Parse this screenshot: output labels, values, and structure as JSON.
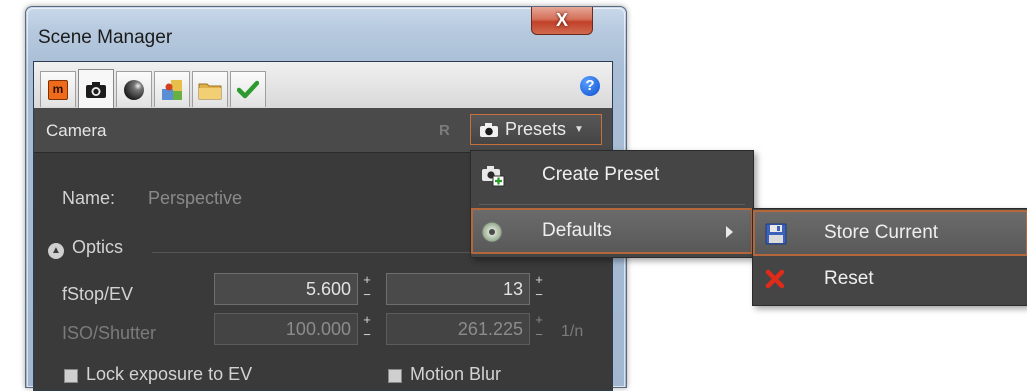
{
  "window": {
    "title": "Scene Manager",
    "close_glyph": "X"
  },
  "tabs": [
    {
      "name": "tab-maxwell",
      "icon": "maxwell-logo-icon"
    },
    {
      "name": "tab-camera",
      "icon": "camera-icon",
      "active": true
    },
    {
      "name": "tab-environment",
      "icon": "sphere-icon"
    },
    {
      "name": "tab-materials",
      "icon": "materials-icon"
    },
    {
      "name": "tab-folder",
      "icon": "folder-icon"
    },
    {
      "name": "tab-render",
      "icon": "checkmark-icon"
    }
  ],
  "help_glyph": "?",
  "header": {
    "title": "Camera",
    "reset_letter": "R",
    "presets_label": "Presets"
  },
  "camera": {
    "name_label": "Name:",
    "name_value": "Perspective",
    "optics_label": "Optics",
    "fstop_label": "fStop/EV",
    "fstop_value": "5.600",
    "ev_value": "13",
    "iso_label": "ISO/Shutter",
    "iso_value": "100.000",
    "shutter_value": "261.225",
    "shutter_unit": "1/n",
    "lock_exposure_label": "Lock exposure to EV",
    "motion_blur_label": "Motion Blur"
  },
  "presets_menu": {
    "items": [
      {
        "label": "Create Preset",
        "icon": "camera-add-icon"
      },
      {
        "label": "Defaults",
        "icon": "disc-icon",
        "has_submenu": true
      }
    ]
  },
  "defaults_submenu": {
    "items": [
      {
        "label": "Store Current",
        "icon": "floppy-disk-icon"
      },
      {
        "label": "Reset",
        "icon": "red-x-icon"
      }
    ]
  },
  "colors": {
    "highlight_border": "#b4673a",
    "panel_bg": "#3a3a3a",
    "menu_bg": "#454545"
  }
}
